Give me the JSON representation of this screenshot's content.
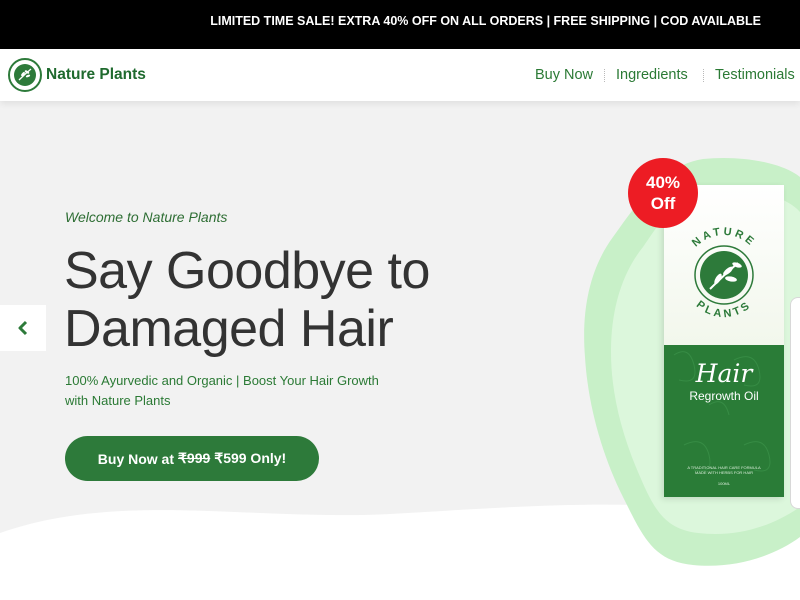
{
  "announcement": {
    "text": "LIMITED TIME SALE! EXTRA 40% OFF ON ALL ORDERS | FREE SHIPPING | COD AVAILABLE"
  },
  "header": {
    "brand_name": "Nature Plants",
    "nav": [
      {
        "label": "Buy Now"
      },
      {
        "label": "Ingredients"
      },
      {
        "label": "Testimonials"
      }
    ]
  },
  "hero": {
    "welcome": "Welcome to Nature Plants",
    "headline_line1": "Say Goodbye to",
    "headline_line2": "Damaged Hair",
    "subtext": "100% Ayurvedic and Organic | Boost Your Hair Growth with Nature Plants",
    "cta": {
      "prefix": "Buy Now at",
      "old_price": "₹999",
      "new_price": "₹599 Only!"
    },
    "prev_arrow_icon": "chevron-left-icon"
  },
  "product": {
    "badge_line1": "40%",
    "badge_line2": "Off",
    "seal_top": "NATURE",
    "seal_bottom": "PLANTS",
    "title": "Hair",
    "subtitle": "Regrowth Oil",
    "small_text": "A TRADITIONAL HAIR CARE FORMULA MADE WITH HERBS FOR HAIR",
    "volume": "100ML"
  },
  "colors": {
    "brand_green": "#2d7a3a",
    "badge_red": "#ed1c24",
    "announcement_bg": "#000000",
    "hero_bg": "#f2f2f2"
  }
}
